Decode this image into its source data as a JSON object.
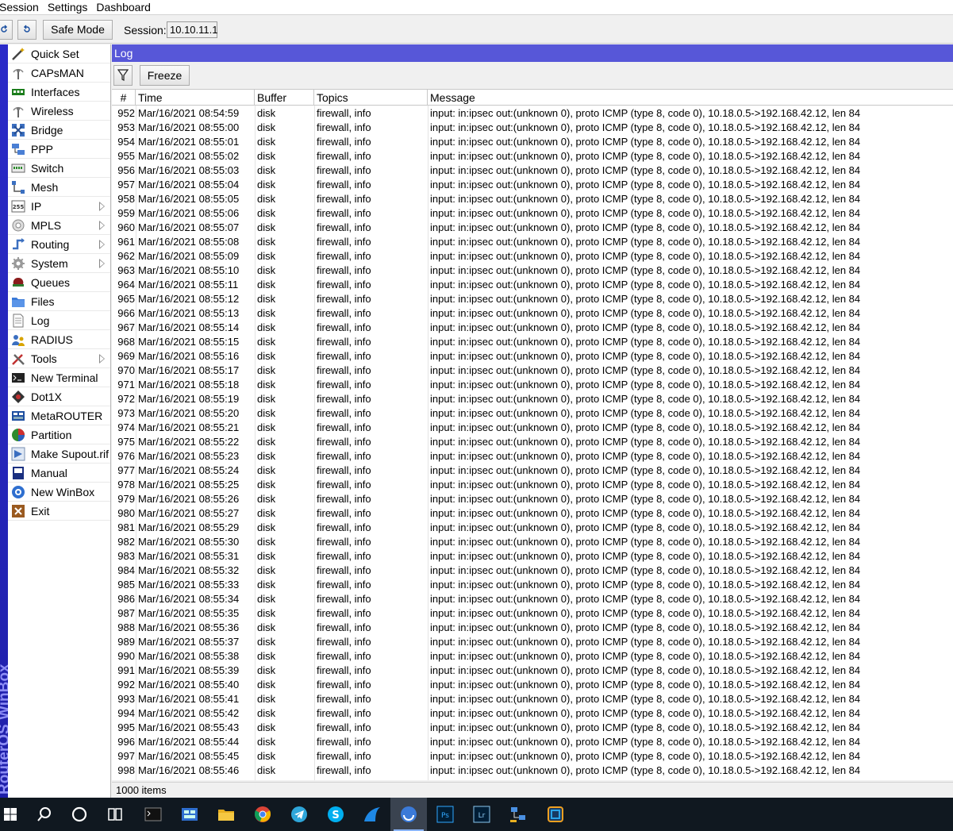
{
  "menu": [
    "Session",
    "Settings",
    "Dashboard"
  ],
  "toolbar": {
    "safe_mode": "Safe Mode",
    "session_label": "Session:",
    "session_value": "10.10.11.1"
  },
  "brand": "RouterOS WinBox",
  "sidebar": {
    "items": [
      {
        "label": "Quick Set",
        "icon": "wand-icon",
        "submenu": false
      },
      {
        "label": "CAPsMAN",
        "icon": "antenna-icon",
        "submenu": false
      },
      {
        "label": "Interfaces",
        "icon": "ethernet-ports-icon",
        "submenu": false
      },
      {
        "label": "Wireless",
        "icon": "antenna-icon",
        "submenu": false
      },
      {
        "label": "Bridge",
        "icon": "bridge-icon",
        "submenu": false
      },
      {
        "label": "PPP",
        "icon": "ppp-icon",
        "submenu": false
      },
      {
        "label": "Switch",
        "icon": "switch-icon",
        "submenu": false
      },
      {
        "label": "Mesh",
        "icon": "mesh-icon",
        "submenu": false
      },
      {
        "label": "IP",
        "icon": "ip-icon",
        "submenu": true
      },
      {
        "label": "MPLS",
        "icon": "mpls-icon",
        "submenu": true
      },
      {
        "label": "Routing",
        "icon": "routing-icon",
        "submenu": true
      },
      {
        "label": "System",
        "icon": "gear-icon",
        "submenu": true
      },
      {
        "label": "Queues",
        "icon": "queues-icon",
        "submenu": false
      },
      {
        "label": "Files",
        "icon": "folder-icon",
        "submenu": false
      },
      {
        "label": "Log",
        "icon": "document-icon",
        "submenu": false
      },
      {
        "label": "RADIUS",
        "icon": "users-icon",
        "submenu": false
      },
      {
        "label": "Tools",
        "icon": "tools-icon",
        "submenu": true
      },
      {
        "label": "New Terminal",
        "icon": "terminal-icon",
        "submenu": false
      },
      {
        "label": "Dot1X",
        "icon": "dot1x-icon",
        "submenu": false
      },
      {
        "label": "MetaROUTER",
        "icon": "metarouter-icon",
        "submenu": false
      },
      {
        "label": "Partition",
        "icon": "pie-chart-icon",
        "submenu": false
      },
      {
        "label": "Make Supout.rif",
        "icon": "supout-icon",
        "submenu": false
      },
      {
        "label": "Manual",
        "icon": "book-icon",
        "submenu": false
      },
      {
        "label": "New WinBox",
        "icon": "winbox-icon",
        "submenu": false
      },
      {
        "label": "Exit",
        "icon": "exit-icon",
        "submenu": false
      }
    ]
  },
  "log": {
    "title": "Log",
    "freeze": "Freeze",
    "columns": [
      "#",
      "Time",
      "Buffer",
      "Topics",
      "Message"
    ],
    "date": "Mar/16/2021",
    "buffer": "disk",
    "topics": "firewall, info",
    "message": "input: in:ipsec out:(unknown 0), proto ICMP (type 8, code 0), 10.18.0.5->192.168.42.12, len 84",
    "rows": [
      [
        "952",
        "08:54:59"
      ],
      [
        "953",
        "08:55:00"
      ],
      [
        "954",
        "08:55:01"
      ],
      [
        "955",
        "08:55:02"
      ],
      [
        "956",
        "08:55:03"
      ],
      [
        "957",
        "08:55:04"
      ],
      [
        "958",
        "08:55:05"
      ],
      [
        "959",
        "08:55:06"
      ],
      [
        "960",
        "08:55:07"
      ],
      [
        "961",
        "08:55:08"
      ],
      [
        "962",
        "08:55:09"
      ],
      [
        "963",
        "08:55:10"
      ],
      [
        "964",
        "08:55:11"
      ],
      [
        "965",
        "08:55:12"
      ],
      [
        "966",
        "08:55:13"
      ],
      [
        "967",
        "08:55:14"
      ],
      [
        "968",
        "08:55:15"
      ],
      [
        "969",
        "08:55:16"
      ],
      [
        "970",
        "08:55:17"
      ],
      [
        "971",
        "08:55:18"
      ],
      [
        "972",
        "08:55:19"
      ],
      [
        "973",
        "08:55:20"
      ],
      [
        "974",
        "08:55:21"
      ],
      [
        "975",
        "08:55:22"
      ],
      [
        "976",
        "08:55:23"
      ],
      [
        "977",
        "08:55:24"
      ],
      [
        "978",
        "08:55:25"
      ],
      [
        "979",
        "08:55:26"
      ],
      [
        "980",
        "08:55:27"
      ],
      [
        "981",
        "08:55:29"
      ],
      [
        "982",
        "08:55:30"
      ],
      [
        "983",
        "08:55:31"
      ],
      [
        "984",
        "08:55:32"
      ],
      [
        "985",
        "08:55:33"
      ],
      [
        "986",
        "08:55:34"
      ],
      [
        "987",
        "08:55:35"
      ],
      [
        "988",
        "08:55:36"
      ],
      [
        "989",
        "08:55:37"
      ],
      [
        "990",
        "08:55:38"
      ],
      [
        "991",
        "08:55:39"
      ],
      [
        "992",
        "08:55:40"
      ],
      [
        "993",
        "08:55:41"
      ],
      [
        "994",
        "08:55:42"
      ],
      [
        "995",
        "08:55:43"
      ],
      [
        "996",
        "08:55:44"
      ],
      [
        "997",
        "08:55:45"
      ],
      [
        "998",
        "08:55:46"
      ]
    ],
    "status": "1000 items"
  },
  "taskbar": {
    "items": [
      {
        "icon": "windows-start-icon",
        "active": false
      },
      {
        "icon": "search-icon",
        "active": false
      },
      {
        "icon": "cortana-icon",
        "active": false
      },
      {
        "icon": "task-view-icon",
        "active": false
      },
      {
        "icon": "terminal-app-icon",
        "active": false
      },
      {
        "icon": "control-panel-icon",
        "active": false
      },
      {
        "icon": "file-explorer-icon",
        "active": false
      },
      {
        "icon": "chrome-icon",
        "active": false
      },
      {
        "icon": "telegram-icon",
        "active": false
      },
      {
        "icon": "skype-icon",
        "active": false
      },
      {
        "icon": "edge-legacy-icon",
        "active": false
      },
      {
        "icon": "winbox-app-icon",
        "active": true
      },
      {
        "icon": "photoshop-icon",
        "active": false
      },
      {
        "icon": "lightroom-icon",
        "active": false
      },
      {
        "icon": "network-app-icon",
        "active": false
      },
      {
        "icon": "virtualbox-icon",
        "active": false
      }
    ]
  }
}
